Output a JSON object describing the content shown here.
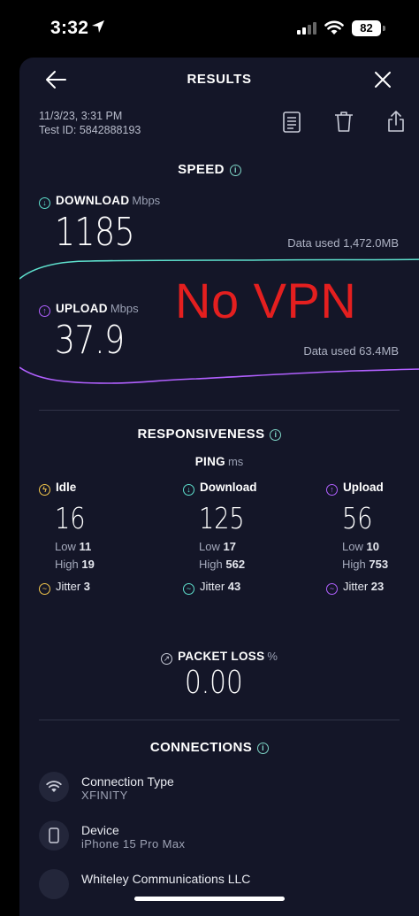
{
  "status": {
    "time": "3:32",
    "battery": "82"
  },
  "header": {
    "title": "RESULTS"
  },
  "meta": {
    "datetime": "11/3/23, 3:31 PM",
    "test_id": "Test ID: 5842888193"
  },
  "speed": {
    "title": "SPEED",
    "download": {
      "label": "DOWNLOAD",
      "unit": "Mbps",
      "value": "1185",
      "data_used": "Data used 1,472.0MB"
    },
    "upload": {
      "label": "UPLOAD",
      "unit": "Mbps",
      "value": "37.9",
      "data_used": "Data used 63.4MB"
    }
  },
  "overlay": {
    "text": "No VPN"
  },
  "responsiveness": {
    "title": "RESPONSIVENESS",
    "ping_label": "PING",
    "ping_unit": "ms",
    "columns": [
      {
        "label": "Idle",
        "value": "16",
        "low_label": "Low",
        "low": "11",
        "high_label": "High",
        "high": "19",
        "jitter_label": "Jitter",
        "jitter": "3"
      },
      {
        "label": "Download",
        "value": "125",
        "low_label": "Low",
        "low": "17",
        "high_label": "High",
        "high": "562",
        "jitter_label": "Jitter",
        "jitter": "43"
      },
      {
        "label": "Upload",
        "value": "56",
        "low_label": "Low",
        "low": "10",
        "high_label": "High",
        "high": "753",
        "jitter_label": "Jitter",
        "jitter": "23"
      }
    ]
  },
  "packet_loss": {
    "label": "PACKET LOSS",
    "unit": "%",
    "value": "0.00"
  },
  "connections": {
    "title": "CONNECTIONS",
    "items": [
      {
        "label": "Connection Type",
        "value": "XFINITY"
      },
      {
        "label": "Device",
        "value": "iPhone 15 Pro Max"
      },
      {
        "label": "Whiteley Communications LLC",
        "value": ""
      }
    ]
  },
  "colors": {
    "download_accent": "#5ee0cd",
    "upload_accent": "#b160ff",
    "idle_accent": "#f3c64b",
    "overlay_red": "#e41f1f",
    "sheet_bg": "#141628"
  }
}
